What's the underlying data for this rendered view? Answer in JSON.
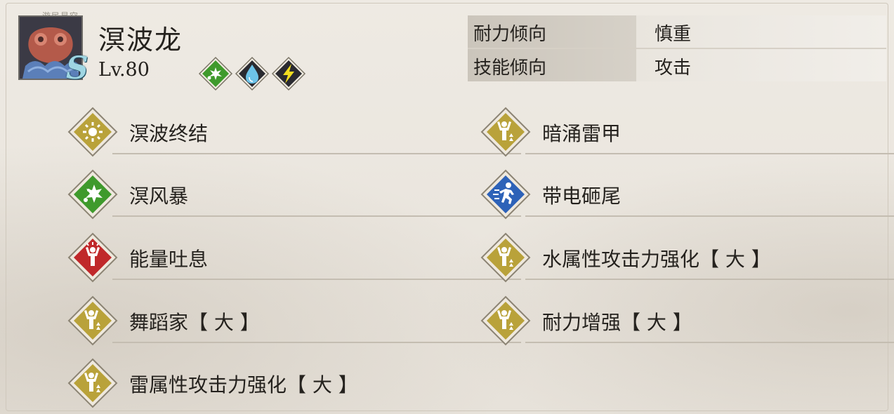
{
  "watermark": "游民星空",
  "monster": {
    "name": "溟波龙",
    "rank": "S",
    "level": "Lv.80",
    "elements": [
      {
        "icon": "wind-burst-icon",
        "color": "#3f9a2c"
      },
      {
        "icon": "water-drop-icon",
        "color": "#2a2a30"
      },
      {
        "icon": "thunder-icon",
        "color": "#2a2a30"
      }
    ]
  },
  "stats": [
    {
      "label": "耐力倾向",
      "value": "慎重"
    },
    {
      "label": "技能倾向",
      "value": "攻击"
    }
  ],
  "skills_left": [
    {
      "name": "溟波终结",
      "icon": "sunburst-icon",
      "color": "#b9a23a"
    },
    {
      "name": "溟风暴",
      "icon": "wind-burst-icon",
      "color": "#3f9a2c"
    },
    {
      "name": "能量吐息",
      "icon": "power-figure-icon",
      "color": "#c0282a"
    },
    {
      "name": "舞蹈家【 大 】",
      "icon": "buff-figure-icon",
      "color": "#b9a23a"
    },
    {
      "name": "雷属性攻击力强化【 大 】",
      "icon": "buff-figure-icon",
      "color": "#b9a23a"
    }
  ],
  "skills_right": [
    {
      "name": "暗涌雷甲",
      "icon": "buff-figure-icon",
      "color": "#b9a23a"
    },
    {
      "name": "带电砸尾",
      "icon": "running-figure-icon",
      "color": "#2d62b8"
    },
    {
      "name": "水属性攻击力强化【 大 】",
      "icon": "buff-figure-icon",
      "color": "#b9a23a"
    },
    {
      "name": "耐力增强【 大 】",
      "icon": "buff-figure-icon",
      "color": "#b9a23a"
    }
  ]
}
